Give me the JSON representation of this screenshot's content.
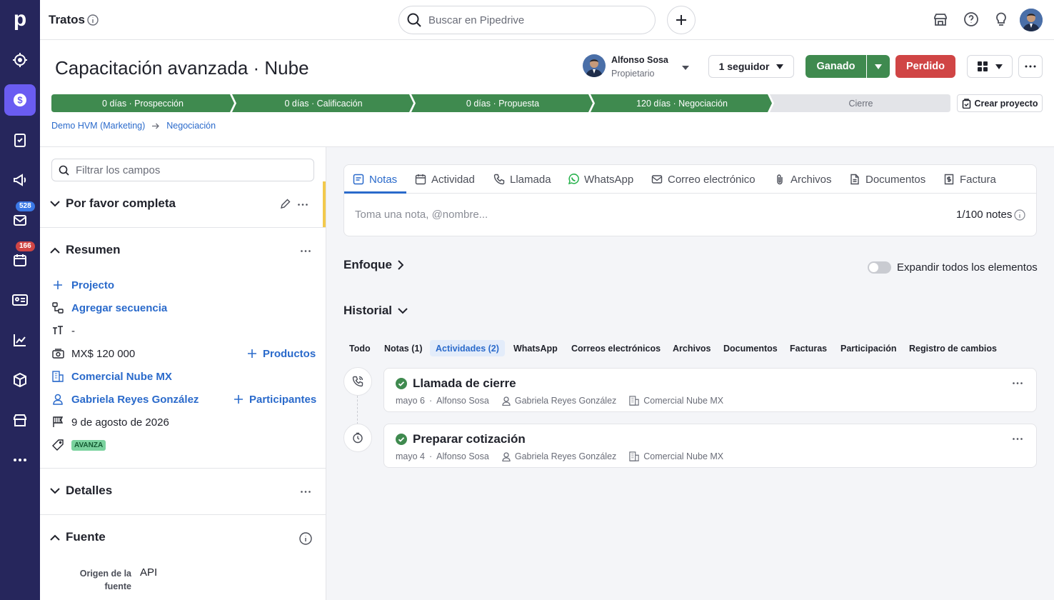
{
  "nav": {
    "logo": "p",
    "badges": {
      "mail": "528",
      "calendar": "166"
    }
  },
  "topbar": {
    "section_title": "Tratos",
    "search_placeholder": "Buscar en Pipedrive"
  },
  "deal": {
    "title": "Capacitación avanzada · Nube",
    "owner_name": "Alfonso Sosa",
    "owner_role": "Propietario",
    "followers": "1 seguidor",
    "won_label": "Ganado",
    "lost_label": "Perdido",
    "create_project": "Crear proyecto"
  },
  "pipeline": {
    "stages": [
      "0 días · Prospección",
      "0 días · Calificación",
      "0 días · Propuesta",
      "120 días · Negociación",
      "Cierre"
    ]
  },
  "breadcrumb": {
    "pipeline": "Demo HVM (Marketing)",
    "stage": "Negociación"
  },
  "left": {
    "filter_placeholder": "Filtrar los campos",
    "complete_title": "Por favor completa",
    "summary_title": "Resumen",
    "project": "Projecto",
    "add_sequence": "Agregar secuencia",
    "text_field": "-",
    "value": "MX$ 120 000",
    "products": "Productos",
    "organization": "Comercial Nube MX",
    "person": "Gabriela Reyes González",
    "participants": "Participantes",
    "close_date": "9 de agosto de 2026",
    "tag": "AVANZA",
    "details_title": "Detalles",
    "source_title": "Fuente",
    "source_label_1": "Origen de la",
    "source_label_2": "fuente",
    "source_value": "API"
  },
  "composer": {
    "tabs": [
      "Notas",
      "Actividad",
      "Llamada",
      "WhatsApp",
      "Correo electrónico",
      "Archivos",
      "Documentos",
      "Factura"
    ],
    "note_placeholder": "Toma una nota, @nombre...",
    "notes_count": "1/100 notes"
  },
  "focus": {
    "title": "Enfoque",
    "expand_label": "Expandir todos los elementos"
  },
  "history": {
    "title": "Historial",
    "filters": [
      "Todo",
      "Notas (1)",
      "Actividades (2)",
      "WhatsApp",
      "Correos electrónicos",
      "Archivos",
      "Documentos",
      "Facturas",
      "Participación",
      "Registro de cambios"
    ],
    "items": [
      {
        "title": "Llamada de cierre",
        "date": "mayo 6",
        "owner": "Alfonso Sosa",
        "person": "Gabriela Reyes González",
        "org": "Comercial Nube MX"
      },
      {
        "title": "Preparar cotización",
        "date": "mayo 4",
        "owner": "Alfonso Sosa",
        "person": "Gabriela Reyes González",
        "org": "Comercial Nube MX"
      }
    ]
  },
  "colors": {
    "nav": "#26265c",
    "accent": "#6a5cf2",
    "stage_done": "#3f8a4f",
    "won": "#3f8a4f",
    "lost": "#d04545",
    "link": "#2a6acb"
  }
}
